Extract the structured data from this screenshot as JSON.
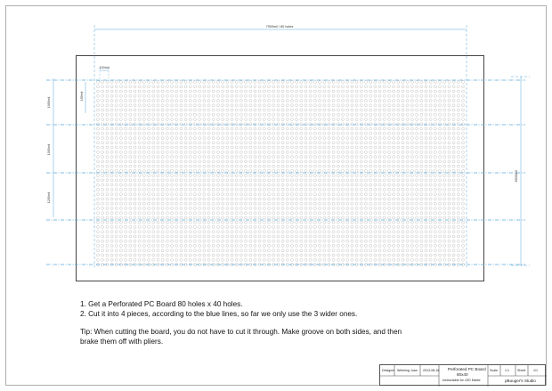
{
  "drawing": {
    "hole_columns": 80,
    "hole_rows": 40,
    "colors": {
      "frame": "#9a9a9a",
      "board_border": "#333333",
      "hole": "#b8b8b8",
      "dimension_line": "#5aa7d8",
      "cut_line": "#5aa7d8"
    },
    "dim_top": "7900mil / 80 holes",
    "dim_pitch": "100mil",
    "dim_right": "3900mil",
    "dim_left_offset": "150mil",
    "dim_left_segments": [
      "1000mil",
      "1000mil",
      "1200mil"
    ]
  },
  "instructions": {
    "step1": "1.  Get  a  Perforated  PC  Board  80  holes  x  40  holes.",
    "step2": "2.  Cut  it  into  4  pieces,  according  to  the  blue  lines,  so  far  we  only  use  the  3  wider  ones.",
    "tip_line1": "Tip:  When  cutting  the  board,  you  do  not  have  to  cut  it  through.  Make  groove  on  both  sides,  and  then",
    "tip_line2": "brake  them  off  with  pliers."
  },
  "title_block": {
    "designer_label": "Designer",
    "designer_name": "Weiming Juan",
    "date": "2013-08-16",
    "title_line1": "Perforated PC Board",
    "title_line2": "80x40",
    "subtitle": "Instructable for  LED  Matrix",
    "scale_label": "Scale",
    "scale_value": "1:1",
    "sheet_label": "Sheet",
    "sheet_value": "1/1",
    "studio": "pBuuger's Studio"
  }
}
